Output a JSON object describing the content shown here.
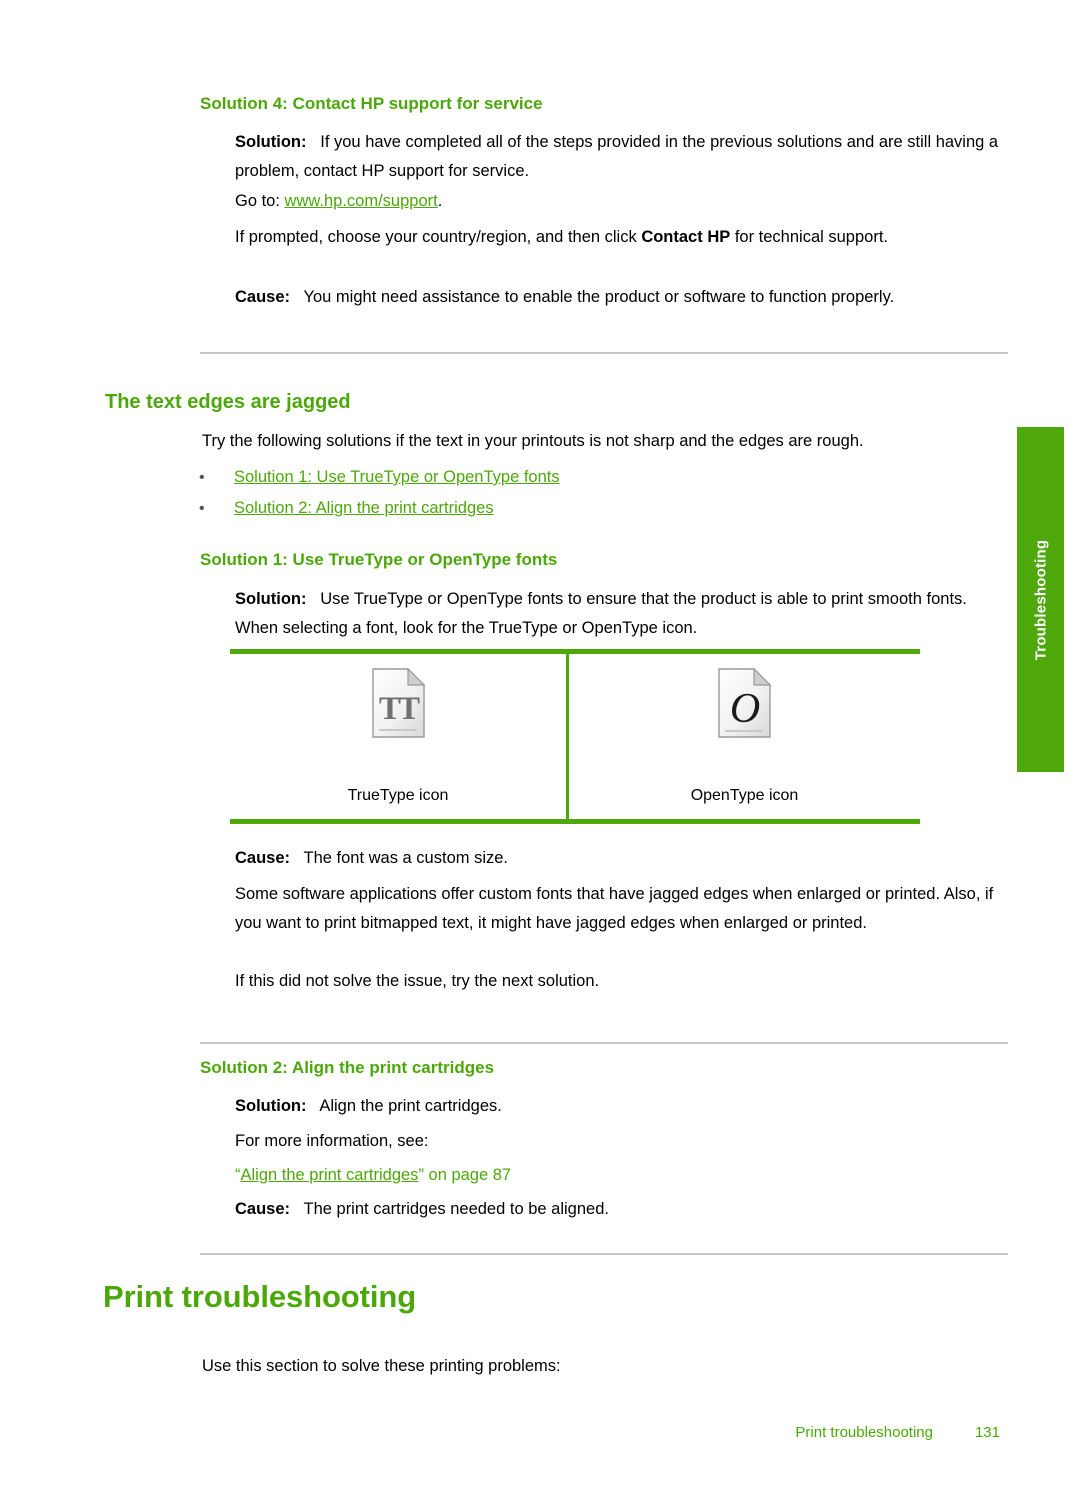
{
  "side_tab": {
    "label": "Troubleshooting"
  },
  "sections": {
    "solution4": {
      "heading": "Solution 4: Contact HP support for service",
      "p1_lead": "Solution:",
      "p1_text": "If you have completed all of the steps provided in the previous solutions and are still having a problem, contact HP support for service.",
      "p2_prefix": "Go to:",
      "p2_link": "www.hp.com/support",
      "p2_suffix": ".",
      "p3_a": "If prompted, choose your country/region, and then click ",
      "p3_bold": "Contact HP",
      "p3_b": " for technical support.",
      "p4_lead": "Cause:",
      "p4_text": "You might need assistance to enable the product or software to function properly."
    },
    "jagged": {
      "heading": "The text edges are jagged",
      "intro": "Try the following solutions if the text in your printouts is not sharp and the edges are rough.",
      "links": [
        "Solution 1: Use TrueType or OpenType fonts",
        "Solution 2: Align the print cartridges"
      ]
    },
    "solution1": {
      "heading": "Solution 1: Use TrueType or OpenType fonts",
      "p1_lead": "Solution:",
      "p1_text": "Use TrueType or OpenType fonts to ensure that the product is able to print smooth fonts. When selecting a font, look for the TrueType or OpenType icon.",
      "table": {
        "left_caption": "TrueType icon",
        "left_icon": "truetype-file-icon",
        "left_glyph": "TT",
        "right_caption": "OpenType icon",
        "right_icon": "opentype-file-icon",
        "right_glyph": "O"
      },
      "p2_lead": "Cause:",
      "p2_text": "The font was a custom size.",
      "p3_text": "Some software applications offer custom fonts that have jagged edges when enlarged or printed. Also, if you want to print bitmapped text, it might have jagged edges when enlarged or printed.",
      "p4_text": "If this did not solve the issue, try the next solution."
    },
    "solution2": {
      "heading": "Solution 2: Align the print cartridges",
      "p1_lead": "Solution:",
      "p1_text": "Align the print cartridges.",
      "p2_text": "For more information, see:",
      "p3_quote_open": "“",
      "p3_link": "Align the print cartridges",
      "p3_quote_close": "”",
      "p3_suffix": " on page 87",
      "p4_lead": "Cause:",
      "p4_text": "The print cartridges needed to be aligned."
    },
    "print_troubleshooting": {
      "heading": "Print troubleshooting",
      "intro": "Use this section to solve these printing problems:"
    }
  },
  "footer": {
    "title": "Print troubleshooting",
    "page": "131"
  },
  "colors": {
    "accent_green": "#4CA80A",
    "tab_green": "#4fa80b",
    "rule_gray": "#c6c6c6",
    "text_black": "#000000"
  }
}
